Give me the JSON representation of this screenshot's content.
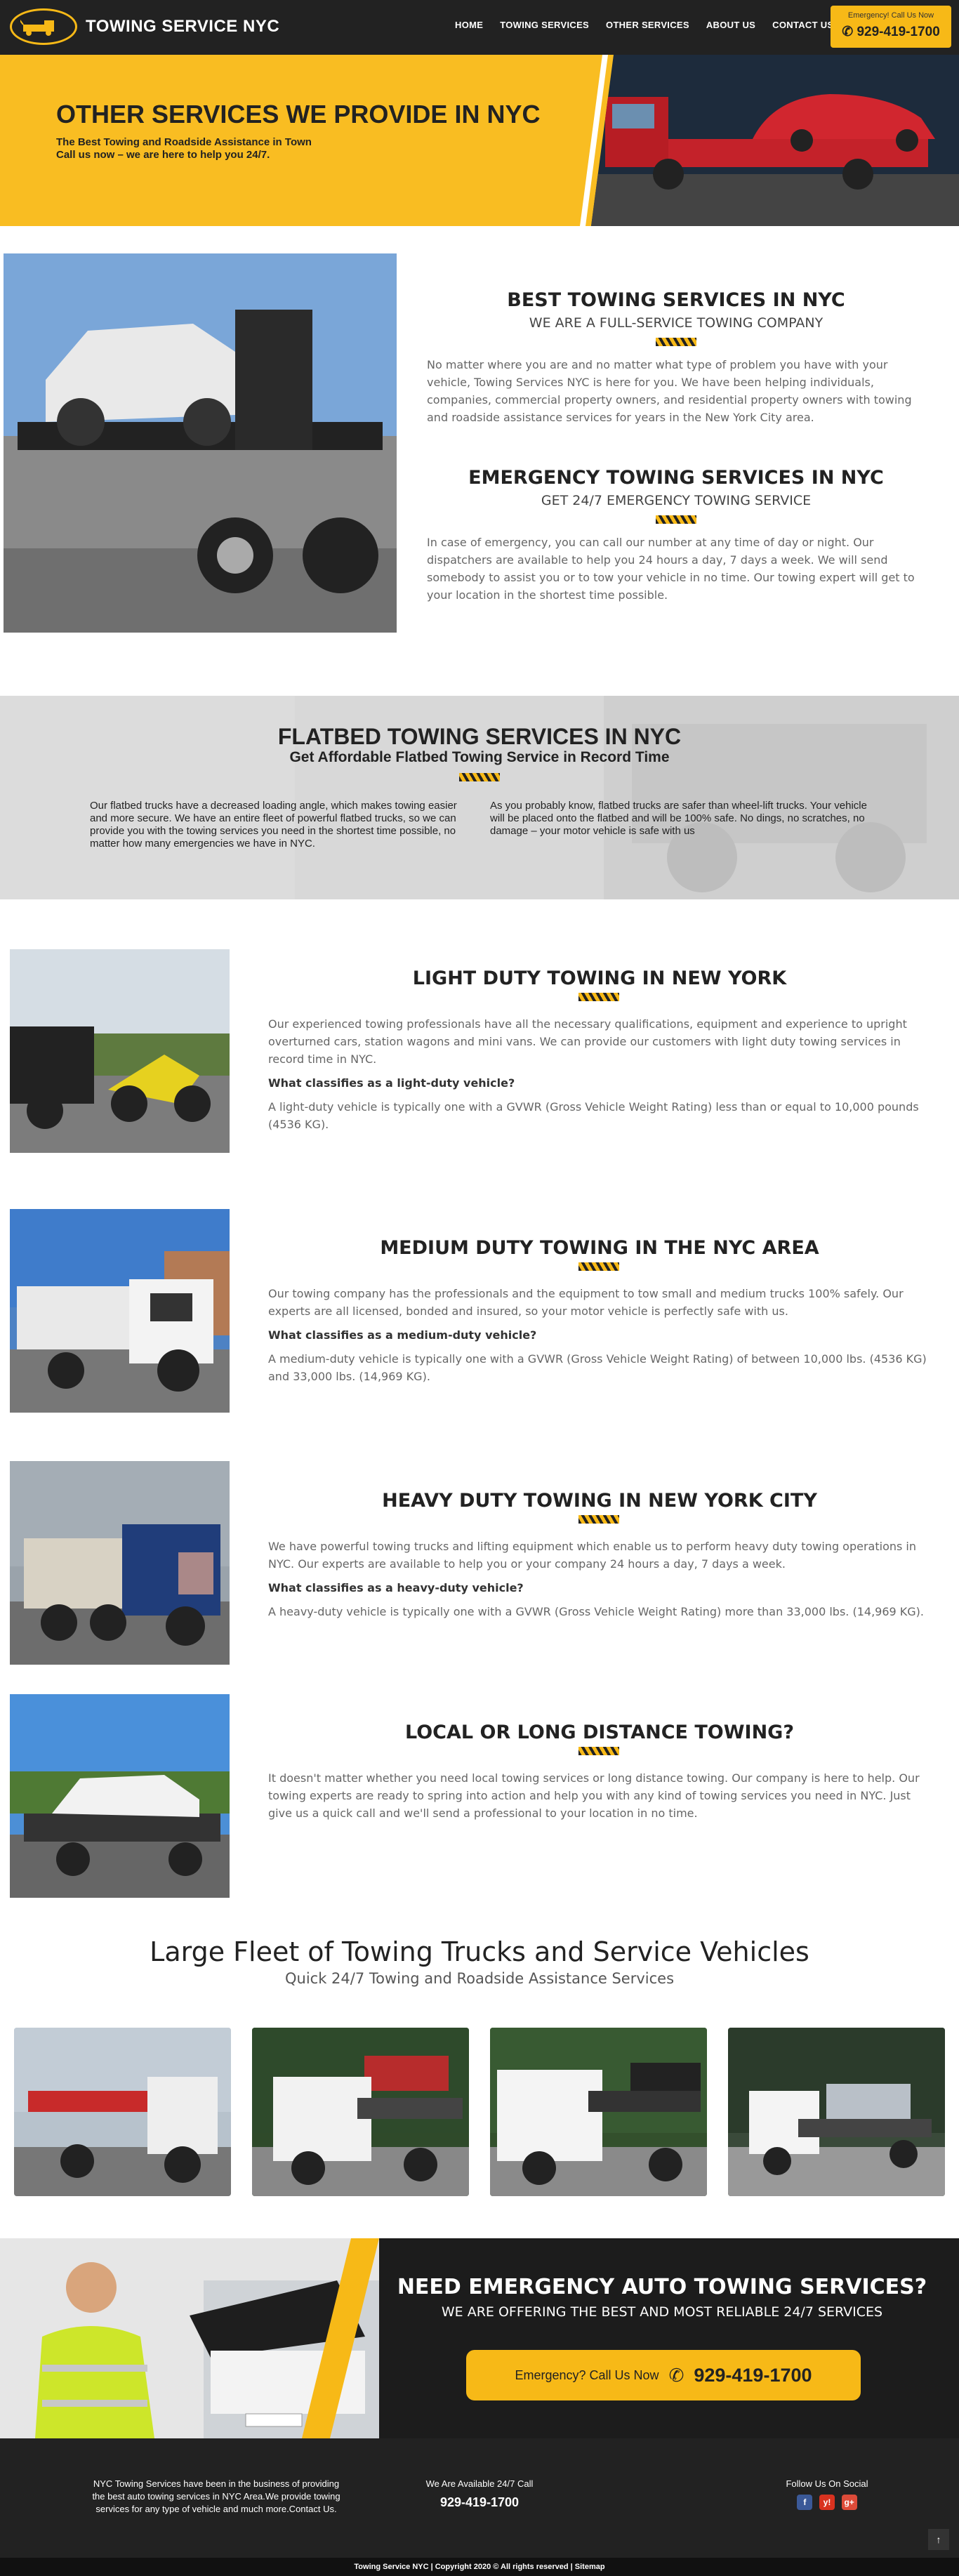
{
  "header": {
    "brand": "TOWING SERVICE NYC",
    "nav": [
      "HOME",
      "TOWING SERVICES",
      "OTHER SERVICES",
      "ABOUT US",
      "CONTACT US"
    ],
    "call_small": "Emergency! Call Us Now",
    "call_number": "929-419-1700"
  },
  "hero": {
    "title": "OTHER SERVICES WE PROVIDE IN NYC",
    "line1": "The Best Towing and Roadside Assistance in Town",
    "line2": "Call us now – we are here to help you 24/7."
  },
  "best": {
    "title": "BEST TOWING SERVICES IN NYC",
    "subtitle": "WE ARE A FULL-SERVICE TOWING COMPANY",
    "text": "No matter where you are and no matter what type of problem you have with your vehicle, Towing Services NYC is here for you. We have been helping individuals, companies, commercial property owners, and residential property owners with towing and roadside assistance services for years in the New York City area."
  },
  "emergency": {
    "title": "EMERGENCY TOWING SERVICES IN NYC",
    "subtitle": "GET 24/7 EMERGENCY TOWING SERVICE",
    "text": "In case of emergency, you can call our number at any time of day or night. Our dispatchers are available to help you 24 hours a day, 7 days a week. We will send somebody to assist you or to tow your vehicle in no time. Our towing expert will get to your location in the shortest time possible."
  },
  "flatbed": {
    "title": "FLATBED TOWING SERVICES IN NYC",
    "subtitle": "Get Affordable Flatbed Towing Service in Record Time",
    "left": "Our flatbed trucks have a decreased loading angle, which makes towing easier and more secure. We have an entire fleet of powerful flatbed trucks, so we can provide you with the towing services you need in the shortest time possible, no matter how many emergencies we have in NYC.",
    "right": "As you probably know, flatbed trucks are safer than wheel-lift trucks. Your vehicle will be placed onto the flatbed and will be 100% safe. No dings, no scratches, no damage – your motor vehicle is safe with us"
  },
  "light": {
    "title": "LIGHT DUTY TOWING IN NEW YORK",
    "text": "Our experienced towing professionals have all the necessary qualifications, equipment and experience to upright overturned cars, station wagons and mini vans. We can provide our customers with light duty towing services in record time in NYC.",
    "question": "What classifies as a light-duty vehicle?",
    "answer": "A light-duty vehicle is typically one with a GVWR (Gross Vehicle Weight Rating) less than or equal to 10,000 pounds (4536 KG)."
  },
  "medium": {
    "title": "MEDIUM DUTY TOWING IN THE NYC AREA",
    "text": "Our towing company has the professionals and the equipment to tow small and medium trucks 100% safely. Our experts are all licensed, bonded and insured, so your motor vehicle is perfectly safe with us.",
    "question": "What classifies as a medium-duty vehicle?",
    "answer": "A medium-duty vehicle is typically one with a GVWR (Gross Vehicle Weight Rating) of between 10,000 lbs. (4536 KG) and 33,000 lbs. (14,969 KG)."
  },
  "heavy": {
    "title": "HEAVY DUTY TOWING IN NEW YORK CITY",
    "text": "We have powerful towing trucks and lifting equipment which enable us to perform heavy duty towing operations in NYC. Our experts are available to help you or your company 24 hours a day, 7 days a week.",
    "question": "What classifies as a heavy-duty vehicle?",
    "answer": "A heavy-duty vehicle is typically one with a GVWR (Gross Vehicle Weight Rating) more than 33,000 lbs. (14,969 KG)."
  },
  "distance": {
    "title": "LOCAL OR LONG DISTANCE TOWING?",
    "text": "It doesn't matter whether you need local towing services or long distance towing. Our company is here to help. Our towing experts are ready to spring into action and help you with any kind of towing services you need in NYC. Just give us a quick call and we'll send a professional to your location in no time."
  },
  "fleet": {
    "title": "Large Fleet of Towing Trucks and Service Vehicles",
    "subtitle": "Quick 24/7 Towing and Roadside Assistance Services"
  },
  "cta": {
    "title": "NEED EMERGENCY AUTO TOWING SERVICES?",
    "subtitle": "WE ARE OFFERING THE BEST AND MOST RELIABLE 24/7 SERVICES",
    "button_label": "Emergency? Call Us Now",
    "button_number": "929-419-1700"
  },
  "footer": {
    "about": "NYC Towing Services have been in the business of providing the best auto towing services in NYC Area.We provide towing services for any type of vehicle and much more.Contact Us.",
    "avail": "We Are Available 24/7 Call",
    "number": "929-419-1700",
    "social_title": "Follow Us On Social",
    "social": [
      "f",
      "y!",
      "g+"
    ],
    "copyright": "Towing Service NYC | Copyright 2020 © All rights reserved | Sitemap"
  },
  "colors": {
    "accent": "#f7b917",
    "dark": "#222222"
  }
}
